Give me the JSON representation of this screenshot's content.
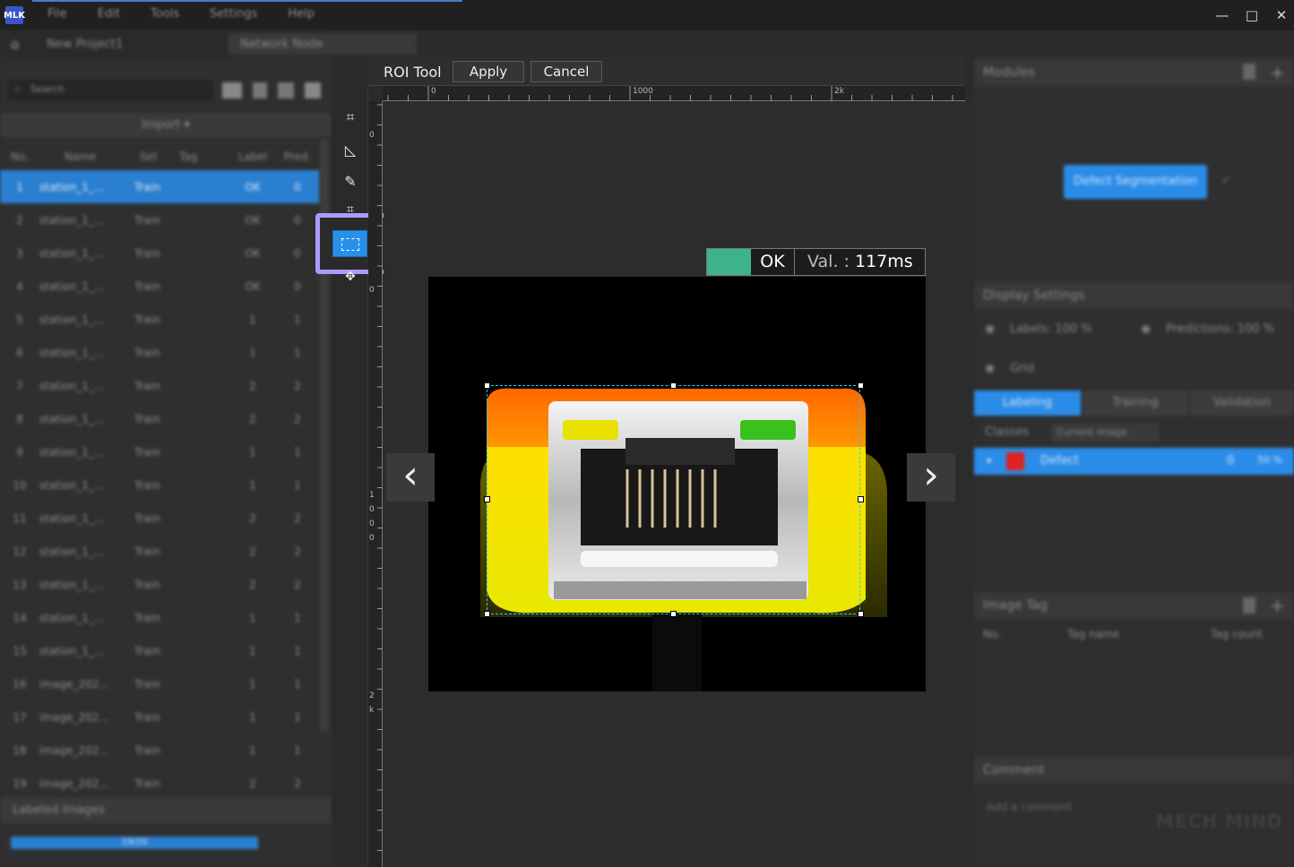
{
  "window": {
    "app_logo": "MLK",
    "menus": [
      "File",
      "Edit",
      "Tools",
      "Settings",
      "Help"
    ],
    "minimize": "—",
    "maximize": "□",
    "close": "✕"
  },
  "left": {
    "project_name": "New Project1",
    "module_name": "Network Node",
    "search_placeholder": "Search",
    "import_label": "Import ▾",
    "columns": [
      "No.",
      "Name",
      "Set",
      "Tag",
      "Label",
      "Pred."
    ],
    "rows": [
      {
        "no": "1",
        "name": "station_1_...",
        "set": "Train",
        "label": "OK",
        "pred": "0"
      },
      {
        "no": "2",
        "name": "station_1_...",
        "set": "Train",
        "label": "OK",
        "pred": "0"
      },
      {
        "no": "3",
        "name": "station_1_...",
        "set": "Train",
        "label": "OK",
        "pred": "0"
      },
      {
        "no": "4",
        "name": "station_1_...",
        "set": "Train",
        "label": "OK",
        "pred": "0"
      },
      {
        "no": "5",
        "name": "station_1_...",
        "set": "Train",
        "label": "1",
        "pred": "1"
      },
      {
        "no": "6",
        "name": "station_1_...",
        "set": "Train",
        "label": "1",
        "pred": "1"
      },
      {
        "no": "7",
        "name": "station_1_...",
        "set": "Train",
        "label": "2",
        "pred": "2"
      },
      {
        "no": "8",
        "name": "station_1_...",
        "set": "Train",
        "label": "2",
        "pred": "2"
      },
      {
        "no": "9",
        "name": "station_1_...",
        "set": "Train",
        "label": "1",
        "pred": "1"
      },
      {
        "no": "10",
        "name": "station_1_...",
        "set": "Train",
        "label": "1",
        "pred": "1"
      },
      {
        "no": "11",
        "name": "station_1_...",
        "set": "Train",
        "label": "2",
        "pred": "2"
      },
      {
        "no": "12",
        "name": "station_1_...",
        "set": "Train",
        "label": "2",
        "pred": "2"
      },
      {
        "no": "13",
        "name": "station_1_...",
        "set": "Train",
        "label": "2",
        "pred": "2"
      },
      {
        "no": "14",
        "name": "station_1_...",
        "set": "Train",
        "label": "1",
        "pred": "1"
      },
      {
        "no": "15",
        "name": "station_1_...",
        "set": "Train",
        "label": "1",
        "pred": "1"
      },
      {
        "no": "16",
        "name": "image_202...",
        "set": "Train",
        "label": "1",
        "pred": "1"
      },
      {
        "no": "17",
        "name": "image_202...",
        "set": "Train",
        "label": "1",
        "pred": "1"
      },
      {
        "no": "18",
        "name": "image_202...",
        "set": "Train",
        "label": "1",
        "pred": "1"
      },
      {
        "no": "19",
        "name": "image_202...",
        "set": "Train",
        "label": "2",
        "pred": "2"
      }
    ],
    "labeled_images_label": "Labeled Images",
    "progress_label": "19/20"
  },
  "toolbar": {
    "title": "ROI Tool",
    "apply": "Apply",
    "cancel": "Cancel"
  },
  "rulers": {
    "h0": "0",
    "h1000": "1000",
    "h2k": "2k",
    "v0": "0",
    "v1000": "1000",
    "v2k": "2k"
  },
  "status": {
    "result": "OK",
    "val_key": "Val. :",
    "val_time": "117ms"
  },
  "right": {
    "modules_title": "Modules",
    "module_node": "Defect Segmentation",
    "display_title": "Display Settings",
    "labels_opt": "Labels: 100 %",
    "predictions_opt": "Predictions: 100 %",
    "grid_opt": "Grid",
    "tabs": [
      "Labeling",
      "Training",
      "Validation"
    ],
    "classes_label": "Classes",
    "classes_filter": "Current image",
    "class_name": "Defect",
    "class_count": "0",
    "class_pct": "50 %",
    "image_tag_title": "Image Tag",
    "tag_cols": [
      "No.",
      "Tag name",
      "Tag count"
    ],
    "comment_title": "Comment",
    "comment_placeholder": "Add a comment",
    "watermark": "MECH MIND"
  },
  "colors": {
    "accent": "#2b7fd0",
    "highlight": "#a99cff",
    "ok_green": "#3db38a",
    "roi_dash": "#2bd0e6",
    "class_red": "#e0211d"
  }
}
